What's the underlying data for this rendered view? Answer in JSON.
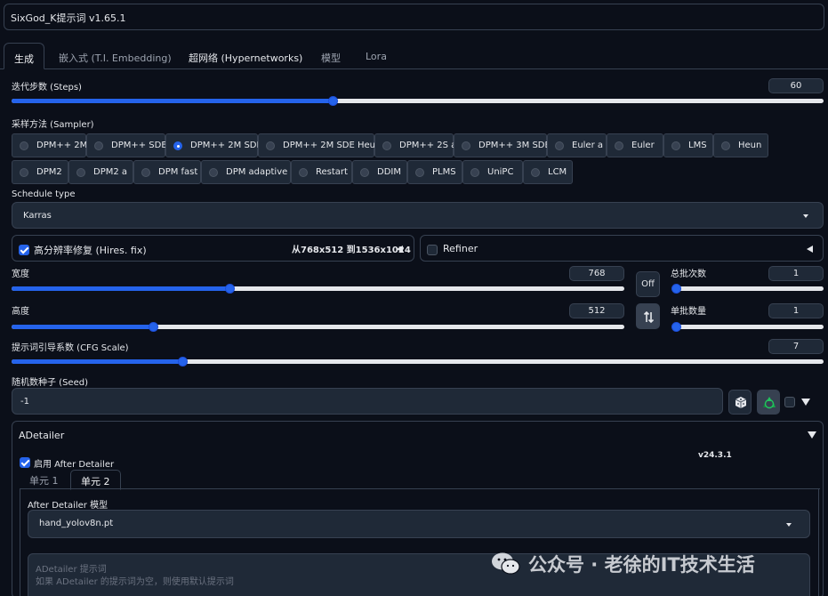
{
  "app_title": "SixGod_K提示词 v1.65.1",
  "tabs": [
    "生成",
    "嵌入式 (T.I. Embedding)",
    "超网络 (Hypernetworks)",
    "模型",
    "Lora"
  ],
  "steps": {
    "label": "迭代步数 (Steps)",
    "value": "60",
    "fraction": 0.395
  },
  "sampler": {
    "label": "采样方法 (Sampler)",
    "selected": "DPM++ 2M SDE",
    "options_row1": [
      "DPM++ 2M",
      "DPM++ SDE",
      "DPM++ 2M SDE",
      "DPM++ 2M SDE Heun",
      "DPM++ 2S a",
      "DPM++ 3M SDE",
      "Euler a",
      "Euler",
      "LMS",
      "Heun"
    ],
    "options_row2": [
      "DPM2",
      "DPM2 a",
      "DPM fast",
      "DPM adaptive",
      "Restart",
      "DDIM",
      "PLMS",
      "UniPC",
      "LCM"
    ]
  },
  "schedule": {
    "label": "Schedule type",
    "value": "Karras"
  },
  "hires": {
    "label": "高分辨率修复 (Hires. fix)",
    "info": "从768x512 到1536x1024",
    "checked": true
  },
  "refiner": {
    "label": "Refiner",
    "checked": false
  },
  "width": {
    "label": "宽度",
    "value": "768",
    "fraction": 0.355
  },
  "height": {
    "label": "高度",
    "value": "512",
    "fraction": 0.231
  },
  "off_button": "Off",
  "batch_count": {
    "label": "总批次数",
    "value": "1",
    "fraction": 0.0
  },
  "batch_size": {
    "label": "单批数量",
    "value": "1",
    "fraction": 0.0
  },
  "cfg": {
    "label": "提示词引导系数 (CFG Scale)",
    "value": "7",
    "fraction": 0.21
  },
  "seed": {
    "label": "随机数种子 (Seed)",
    "value": "-1"
  },
  "adetailer": {
    "title": "ADetailer",
    "enable_label": "启用 After Detailer",
    "version": "v24.3.1",
    "unit_tabs": [
      "单元 1",
      "单元 2"
    ],
    "model_label": "After Detailer 模型",
    "model_value": "hand_yolov8n.pt",
    "prompt_label": "ADetailer 提示词",
    "prompt_placeholder": "如果 ADetailer 的提示词为空，则使用默认提示词"
  },
  "watermark": "公众号 · 老徐的IT技术生活",
  "colors": {
    "accent": "#2563eb",
    "background": "#0b0f19",
    "input": "#1f2937",
    "border": "#374151"
  },
  "icons": [
    "dice-icon",
    "recycle-icon",
    "swap-icon",
    "wechat-icon"
  ]
}
